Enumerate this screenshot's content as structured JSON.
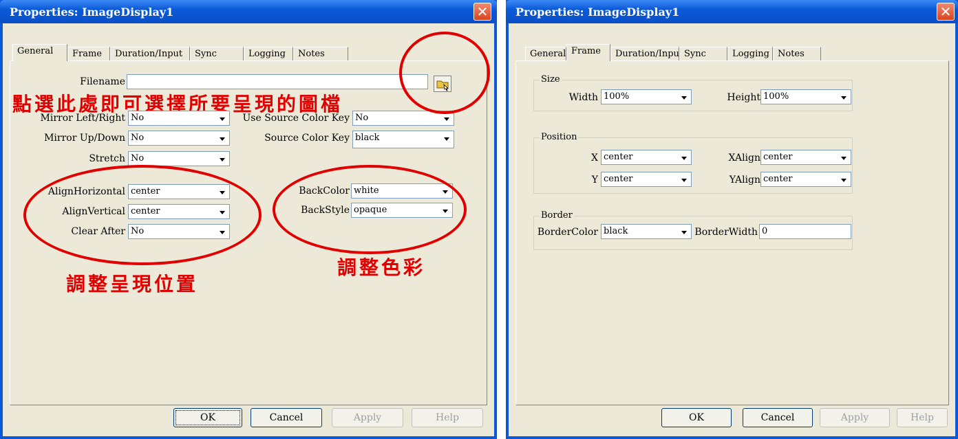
{
  "left_dialog": {
    "title": "Properties: ImageDisplay1",
    "tabs": [
      "General",
      "Frame",
      "Duration/Input",
      "Sync",
      "Logging",
      "Notes"
    ],
    "active_tab": "General",
    "filename_label": "Filename",
    "filename_value": "",
    "fields": {
      "mirror_lr": {
        "label": "Mirror Left/Right",
        "value": "No"
      },
      "mirror_ud": {
        "label": "Mirror Up/Down",
        "value": "No"
      },
      "stretch": {
        "label": "Stretch",
        "value": "No"
      },
      "use_source_color_key": {
        "label": "Use Source Color Key",
        "value": "No"
      },
      "source_color_key": {
        "label": "Source Color Key",
        "value": "black"
      },
      "align_horizontal": {
        "label": "AlignHorizontal",
        "value": "center"
      },
      "align_vertical": {
        "label": "AlignVertical",
        "value": "center"
      },
      "clear_after": {
        "label": "Clear After",
        "value": "No"
      },
      "back_color": {
        "label": "BackColor",
        "value": "white"
      },
      "back_style": {
        "label": "BackStyle",
        "value": "opaque"
      }
    },
    "buttons": {
      "ok": "OK",
      "cancel": "Cancel",
      "apply": "Apply",
      "help": "Help"
    },
    "annotations": {
      "select_file": "點選此處即可選擇所要呈現的圖檔",
      "adjust_position": "調整呈現位置",
      "adjust_color": "調整色彩"
    }
  },
  "right_dialog": {
    "title": "Properties: ImageDisplay1",
    "tabs": [
      "General",
      "Frame",
      "Duration/Input",
      "Sync",
      "Logging",
      "Notes"
    ],
    "active_tab": "Frame",
    "size_group": {
      "label": "Size",
      "width_label": "Width",
      "width_value": "100%",
      "height_label": "Height",
      "height_value": "100%"
    },
    "position_group": {
      "label": "Position",
      "x_label": "X",
      "x_value": "center",
      "y_label": "Y",
      "y_value": "center",
      "xalign_label": "XAlign",
      "xalign_value": "center",
      "yalign_label": "YAlign",
      "yalign_value": "center"
    },
    "border_group": {
      "label": "Border",
      "bordercolor_label": "BorderColor",
      "bordercolor_value": "black",
      "borderwidth_label": "BorderWidth",
      "borderwidth_value": "0"
    },
    "buttons": {
      "ok": "OK",
      "cancel": "Cancel",
      "apply": "Apply",
      "help": "Help"
    }
  },
  "colors": {
    "titlebar": "#0a5ad8",
    "dialog_face": "#ece9d8",
    "annotation": "#e00000",
    "close_button": "#d9451f"
  }
}
